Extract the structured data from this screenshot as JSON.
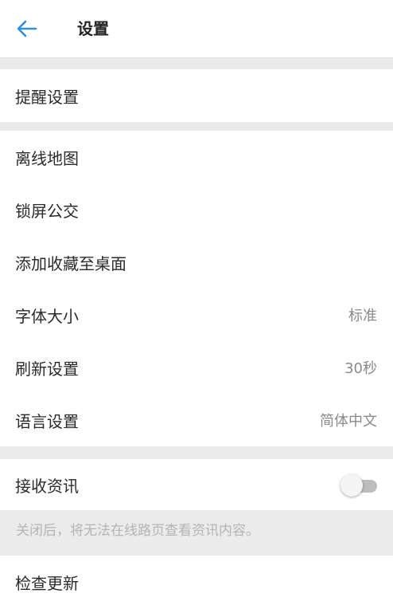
{
  "header": {
    "title": "设置",
    "back_icon": "arrow-left-icon",
    "accent_color": "#2f8fd8"
  },
  "group1": {
    "items": [
      {
        "label": "提醒设置"
      }
    ]
  },
  "group2": {
    "items": [
      {
        "label": "离线地图",
        "value": ""
      },
      {
        "label": "锁屏公交",
        "value": ""
      },
      {
        "label": "添加收藏至桌面",
        "value": ""
      },
      {
        "label": "字体大小",
        "value": "标准"
      },
      {
        "label": "刷新设置",
        "value": "30秒"
      },
      {
        "label": "语言设置",
        "value": "简体中文"
      }
    ]
  },
  "group3": {
    "news": {
      "label": "接收资讯",
      "enabled": false
    },
    "hint": "关闭后，将无法在线路页查看资讯内容。"
  },
  "group4": {
    "items": [
      {
        "label": "检查更新"
      }
    ]
  }
}
